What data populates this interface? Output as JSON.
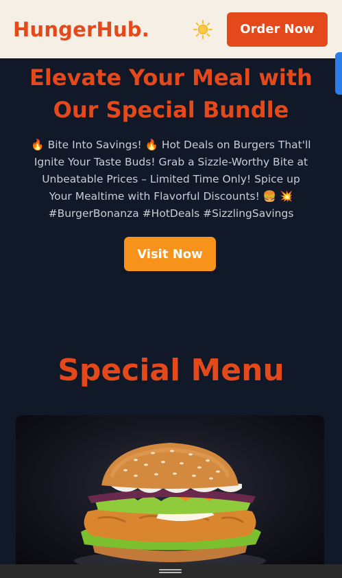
{
  "header": {
    "brand": "HungerHub.",
    "theme_icon": "sun-icon",
    "order_label": "Order Now"
  },
  "hero": {
    "title_line1": "Elevate Your Meal with",
    "title_line2": "Our Special Bundle",
    "desc_line1": "🔥 Bite Into Savings! 🔥 Hot Deals on Burgers That'll",
    "desc_line2": "Ignite Your Taste Buds! Grab a Sizzle-Worthy Bite at",
    "desc_line3": "Unbeatable Prices – Limited Time Only! Spice up",
    "desc_line4": "Your Mealtime with Flavorful Discounts! 🍔 💥",
    "desc_line5": "#BurgerBonanza #HotDeals #SizzlingSavings",
    "cta_label": "Visit Now"
  },
  "menu": {
    "title": "Special Menu",
    "image_subject": "burger"
  },
  "colors": {
    "brand": "#e4491c",
    "cta": "#f7931a",
    "background": "#111827",
    "header_bg": "#f6efe6"
  }
}
